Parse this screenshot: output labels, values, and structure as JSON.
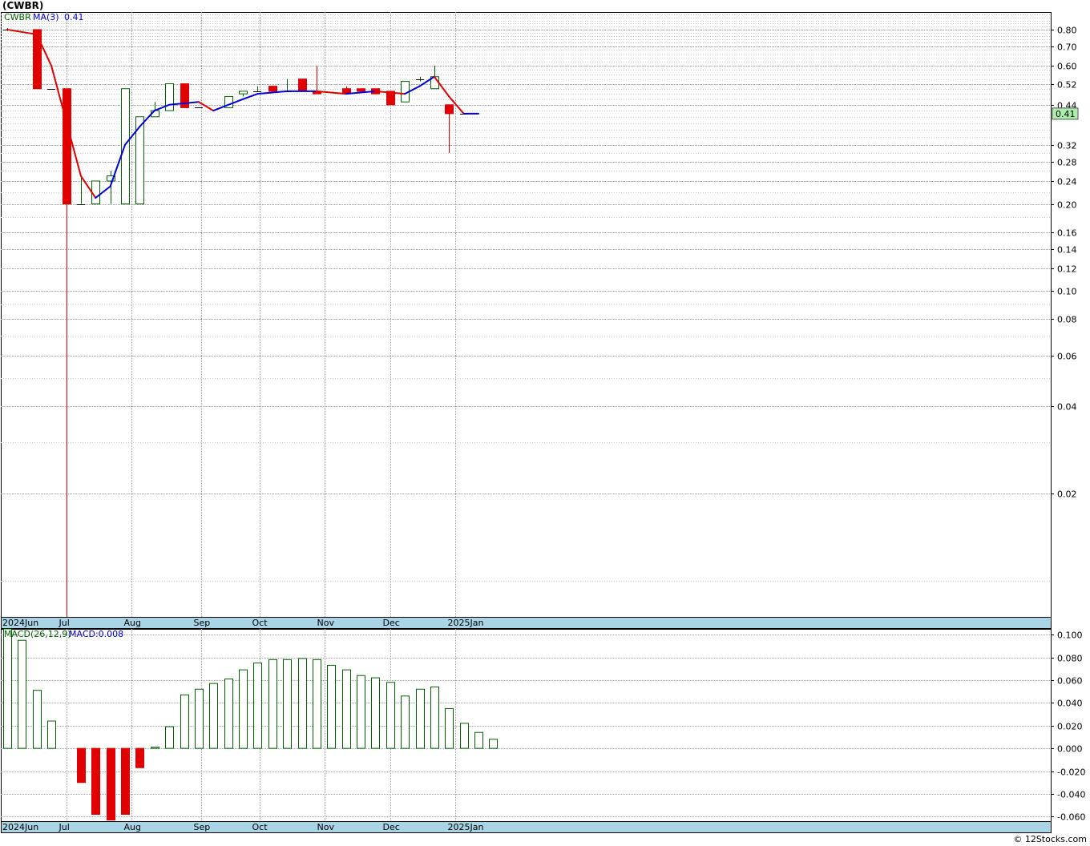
{
  "title": "(CWBR)",
  "footer": "© 12Stocks.com",
  "colors": {
    "background": "#ffffff",
    "up_candle": "#006400",
    "down_candle": "#e00000",
    "ma_up": "#0000dd",
    "ma_down": "#e00000",
    "macd_pos": "#006400",
    "macd_neg": "#e00000",
    "axis_band": "#a8d4e6",
    "price_label_bg": "#aaf0aa"
  },
  "legend": {
    "symbol": "CWBR",
    "ma_label": "MA(3)",
    "ma_value": "0.41"
  },
  "last_price_label": "0.41",
  "macd_legend": {
    "label": "MACD(26,12,9)",
    "value_label": "MACD:0.008"
  },
  "month_labels": [
    "2024Jun",
    "Jul",
    "Aug",
    "Sep",
    "Oct",
    "Nov",
    "Dec",
    "2025Jan"
  ],
  "chart_data": [
    {
      "type": "candlestick",
      "scale": "log",
      "ylim": [
        0.0075,
        0.92
      ],
      "y_ticks": [
        "0.80",
        "0.70",
        "0.60",
        "0.52",
        "0.44",
        "0.32",
        "0.28",
        "0.24",
        "0.20",
        "0.16",
        "0.14",
        "0.12",
        "0.10",
        "0.08",
        "0.06",
        "0.04",
        "0.02"
      ],
      "candles": [
        {
          "week": "2024-06-03",
          "open": 0.8,
          "high": 0.81,
          "low": 0.79,
          "close": 0.8
        },
        {
          "week": "2024-06-17",
          "open": 0.8,
          "high": 0.8,
          "low": 0.5,
          "close": 0.5
        },
        {
          "week": "2024-06-24",
          "open": 0.5,
          "high": 0.5,
          "low": 0.5,
          "close": 0.5
        },
        {
          "week": "2024-07-01",
          "open": 0.5,
          "high": 0.5,
          "low": 1e-05,
          "close": 0.2
        },
        {
          "week": "2024-07-08",
          "open": 0.2,
          "high": 0.25,
          "low": 0.2,
          "close": 0.2
        },
        {
          "week": "2024-07-15",
          "open": 0.2,
          "high": 0.24,
          "low": 0.2,
          "close": 0.24
        },
        {
          "week": "2024-07-22",
          "open": 0.24,
          "high": 0.26,
          "low": 0.2,
          "close": 0.25
        },
        {
          "week": "2024-07-29",
          "open": 0.2,
          "high": 0.5,
          "low": 0.2,
          "close": 0.5
        },
        {
          "week": "2024-08-05",
          "open": 0.2,
          "high": 0.4,
          "low": 0.2,
          "close": 0.4
        },
        {
          "week": "2024-08-12",
          "open": 0.4,
          "high": 0.45,
          "low": 0.4,
          "close": 0.42
        },
        {
          "week": "2024-08-19",
          "open": 0.42,
          "high": 0.52,
          "low": 0.42,
          "close": 0.52
        },
        {
          "week": "2024-08-26",
          "open": 0.52,
          "high": 0.52,
          "low": 0.43,
          "close": 0.43
        },
        {
          "week": "2024-09-02",
          "open": 0.43,
          "high": 0.43,
          "low": 0.43,
          "close": 0.43
        },
        {
          "week": "2024-09-16",
          "open": 0.43,
          "high": 0.47,
          "low": 0.43,
          "close": 0.47
        },
        {
          "week": "2024-09-23",
          "open": 0.48,
          "high": 0.49,
          "low": 0.47,
          "close": 0.49
        },
        {
          "week": "2024-09-30",
          "open": 0.49,
          "high": 0.51,
          "low": 0.49,
          "close": 0.49
        },
        {
          "week": "2024-10-07",
          "open": 0.51,
          "high": 0.51,
          "low": 0.49,
          "close": 0.49
        },
        {
          "week": "2024-10-14",
          "open": 0.49,
          "high": 0.54,
          "low": 0.49,
          "close": 0.49
        },
        {
          "week": "2024-10-21",
          "open": 0.54,
          "high": 0.54,
          "low": 0.49,
          "close": 0.49
        },
        {
          "week": "2024-10-28",
          "open": 0.49,
          "high": 0.6,
          "low": 0.48,
          "close": 0.48
        },
        {
          "week": "2024-11-11",
          "open": 0.5,
          "high": 0.51,
          "low": 0.48,
          "close": 0.48
        },
        {
          "week": "2024-11-18",
          "open": 0.5,
          "high": 0.5,
          "low": 0.49,
          "close": 0.49
        },
        {
          "week": "2024-11-25",
          "open": 0.5,
          "high": 0.5,
          "low": 0.48,
          "close": 0.48
        },
        {
          "week": "2024-12-02",
          "open": 0.49,
          "high": 0.49,
          "low": 0.44,
          "close": 0.44
        },
        {
          "week": "2024-12-09",
          "open": 0.45,
          "high": 0.53,
          "low": 0.45,
          "close": 0.53
        },
        {
          "week": "2024-12-16",
          "open": 0.54,
          "high": 0.55,
          "low": 0.53,
          "close": 0.54
        },
        {
          "week": "2024-12-23",
          "open": 0.5,
          "high": 0.6,
          "low": 0.5,
          "close": 0.55
        },
        {
          "week": "2024-12-30",
          "open": 0.44,
          "high": 0.44,
          "low": 0.3,
          "close": 0.41
        },
        {
          "week": "2025-01-06",
          "open": 0.41,
          "high": 0.41,
          "low": 0.41,
          "close": 0.41
        }
      ],
      "ma3": [
        {
          "week": "2024-06-03",
          "value": 0.8
        },
        {
          "week": "2024-06-17",
          "value": 0.77
        },
        {
          "week": "2024-06-24",
          "value": 0.6
        },
        {
          "week": "2024-07-08",
          "value": 0.25
        },
        {
          "week": "2024-07-15",
          "value": 0.21
        },
        {
          "week": "2024-07-22",
          "value": 0.23
        },
        {
          "week": "2024-07-29",
          "value": 0.32
        },
        {
          "week": "2024-08-05",
          "value": 0.37
        },
        {
          "week": "2024-08-12",
          "value": 0.42
        },
        {
          "week": "2024-08-19",
          "value": 0.44
        },
        {
          "week": "2024-09-02",
          "value": 0.45
        },
        {
          "week": "2024-09-09",
          "value": 0.42
        },
        {
          "week": "2024-09-23",
          "value": 0.46
        },
        {
          "week": "2024-09-30",
          "value": 0.48
        },
        {
          "week": "2024-10-14",
          "value": 0.49
        },
        {
          "week": "2024-10-21",
          "value": 0.49
        },
        {
          "week": "2024-10-28",
          "value": 0.49
        },
        {
          "week": "2024-11-11",
          "value": 0.48
        },
        {
          "week": "2024-11-25",
          "value": 0.49
        },
        {
          "week": "2024-12-09",
          "value": 0.48
        },
        {
          "week": "2024-12-16",
          "value": 0.51
        },
        {
          "week": "2024-12-23",
          "value": 0.55
        },
        {
          "week": "2024-12-30",
          "value": 0.47
        },
        {
          "week": "2025-01-06",
          "value": 0.41
        },
        {
          "week": "2025-01-13",
          "value": 0.41
        }
      ]
    },
    {
      "type": "bar",
      "ylim": [
        -0.064,
        0.105
      ],
      "y_ticks": [
        "0.100",
        "0.080",
        "0.060",
        "0.040",
        "0.020",
        "0.000",
        "-0.020",
        "-0.040",
        "-0.060"
      ],
      "bars": [
        {
          "week": "2024-06-03",
          "value": 0.105
        },
        {
          "week": "2024-06-10",
          "value": 0.095
        },
        {
          "week": "2024-06-17",
          "value": 0.051
        },
        {
          "week": "2024-06-24",
          "value": 0.024
        },
        {
          "week": "2024-07-08",
          "value": -0.03
        },
        {
          "week": "2024-07-15",
          "value": -0.058
        },
        {
          "week": "2024-07-22",
          "value": -0.063
        },
        {
          "week": "2024-07-29",
          "value": -0.058
        },
        {
          "week": "2024-08-05",
          "value": -0.017
        },
        {
          "week": "2024-08-12",
          "value": 0.001
        },
        {
          "week": "2024-08-19",
          "value": 0.019
        },
        {
          "week": "2024-08-26",
          "value": 0.047
        },
        {
          "week": "2024-09-02",
          "value": 0.052
        },
        {
          "week": "2024-09-09",
          "value": 0.057
        },
        {
          "week": "2024-09-16",
          "value": 0.061
        },
        {
          "week": "2024-09-23",
          "value": 0.069
        },
        {
          "week": "2024-09-30",
          "value": 0.075
        },
        {
          "week": "2024-10-07",
          "value": 0.078
        },
        {
          "week": "2024-10-14",
          "value": 0.078
        },
        {
          "week": "2024-10-21",
          "value": 0.079
        },
        {
          "week": "2024-10-28",
          "value": 0.078
        },
        {
          "week": "2024-11-04",
          "value": 0.073
        },
        {
          "week": "2024-11-11",
          "value": 0.069
        },
        {
          "week": "2024-11-18",
          "value": 0.064
        },
        {
          "week": "2024-11-25",
          "value": 0.062
        },
        {
          "week": "2024-12-02",
          "value": 0.058
        },
        {
          "week": "2024-12-09",
          "value": 0.046
        },
        {
          "week": "2024-12-16",
          "value": 0.052
        },
        {
          "week": "2024-12-23",
          "value": 0.054
        },
        {
          "week": "2024-12-30",
          "value": 0.035
        },
        {
          "week": "2025-01-06",
          "value": 0.022
        },
        {
          "week": "2025-01-13",
          "value": 0.014
        },
        {
          "week": "2025-01-20",
          "value": 0.008
        }
      ]
    }
  ]
}
